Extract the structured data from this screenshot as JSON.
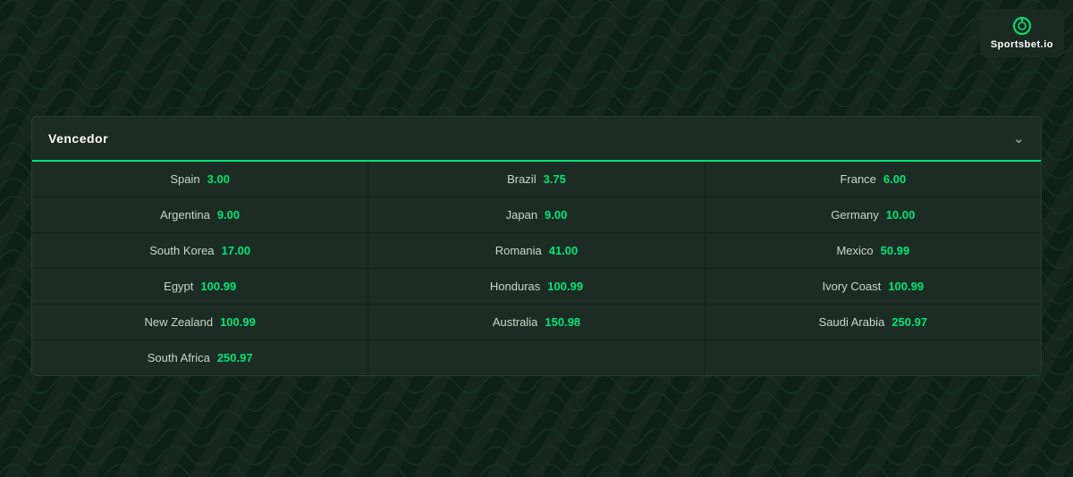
{
  "logo": {
    "name": "Sportsbet.io",
    "icon_symbol": "⊙"
  },
  "panel": {
    "title": "Vencedor",
    "chevron": "❯",
    "rows": [
      [
        {
          "country": "Spain",
          "odds": "3.00"
        },
        {
          "country": "Brazil",
          "odds": "3.75"
        },
        {
          "country": "France",
          "odds": "6.00"
        }
      ],
      [
        {
          "country": "Argentina",
          "odds": "9.00"
        },
        {
          "country": "Japan",
          "odds": "9.00"
        },
        {
          "country": "Germany",
          "odds": "10.00"
        }
      ],
      [
        {
          "country": "South Korea",
          "odds": "17.00"
        },
        {
          "country": "Romania",
          "odds": "41.00"
        },
        {
          "country": "Mexico",
          "odds": "50.99"
        }
      ],
      [
        {
          "country": "Egypt",
          "odds": "100.99"
        },
        {
          "country": "Honduras",
          "odds": "100.99"
        },
        {
          "country": "Ivory Coast",
          "odds": "100.99"
        }
      ],
      [
        {
          "country": "New Zealand",
          "odds": "100.99"
        },
        {
          "country": "Australia",
          "odds": "150.98"
        },
        {
          "country": "Saudi Arabia",
          "odds": "250.97"
        }
      ],
      [
        {
          "country": "South Africa",
          "odds": "250.97"
        },
        null,
        null
      ]
    ]
  }
}
